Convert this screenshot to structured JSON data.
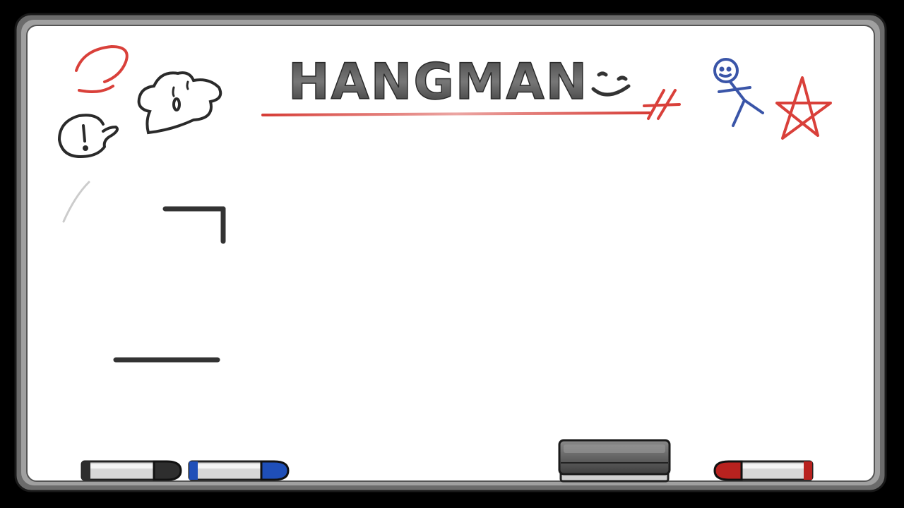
{
  "game": {
    "title": "HANGMAN",
    "title_smiley": "smiley-face",
    "hangman_stage": 0
  },
  "doodles": [
    "red-squiggle-icon",
    "speech-bubble-exclaim-icon",
    "ghost-blob-icon",
    "stick-figure-icon",
    "star-icon",
    "tally-marks-icon"
  ],
  "tray": {
    "markers": [
      {
        "name": "black-marker",
        "color": "#2e2e2e"
      },
      {
        "name": "blue-marker",
        "color": "#1f4fb8"
      },
      {
        "name": "red-marker",
        "color": "#b8221f"
      }
    ],
    "eraser": "eraser"
  },
  "colors": {
    "frame_outer": "#1a1a1a",
    "frame_inner": "#9a9a9a",
    "board": "#ffffff",
    "ink_black": "#2a2a2a",
    "ink_red": "#d9403a",
    "ink_blue": "#3a55a8"
  }
}
